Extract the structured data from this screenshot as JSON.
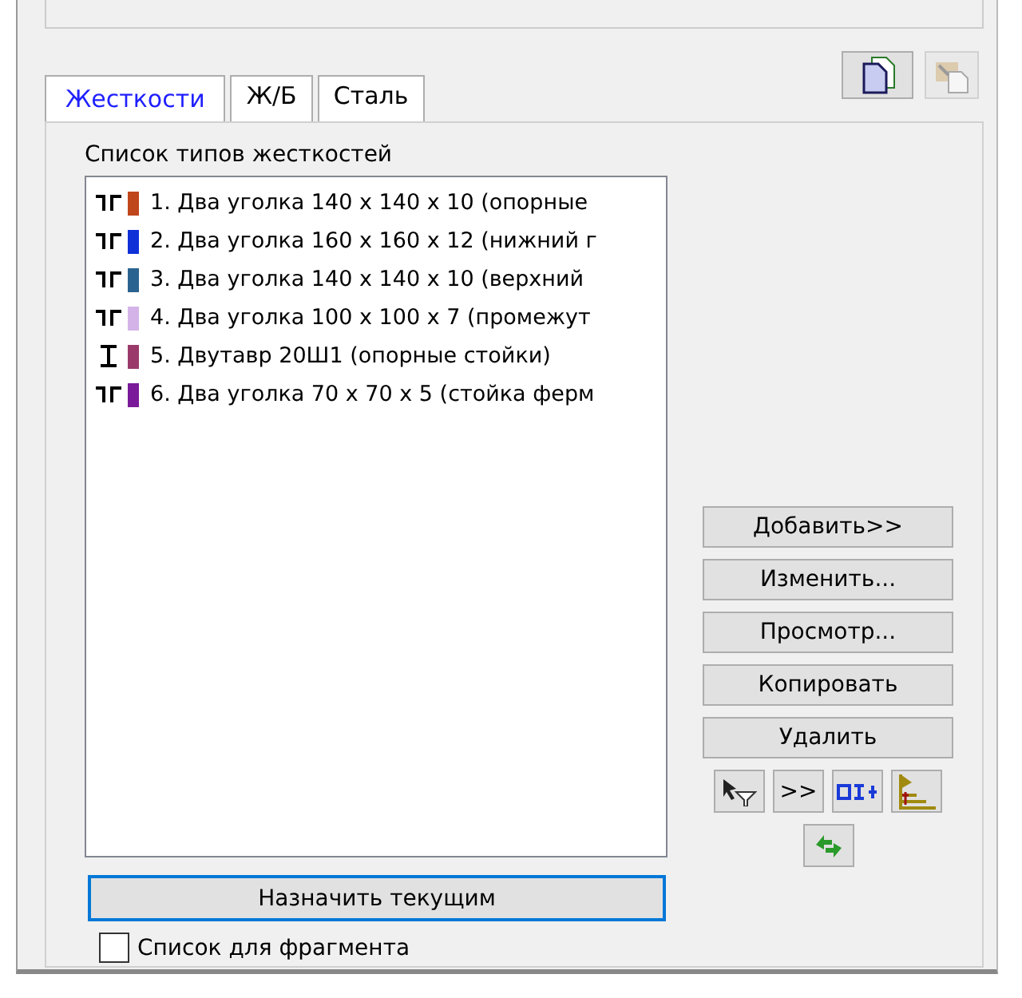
{
  "tabs": [
    {
      "label": "Жесткости",
      "selected": true
    },
    {
      "label": "Ж/Б",
      "selected": false
    },
    {
      "label": "Сталь",
      "selected": false
    }
  ],
  "toolbar": [
    {
      "kind": "copy",
      "disabled": false
    },
    {
      "kind": "paste",
      "disabled": true
    }
  ],
  "list": {
    "label": "Список типов жесткостей",
    "items": [
      {
        "kind": "angles",
        "color": "#c0461b",
        "text": "1. Два уголка 140 x 140 x 10 (опорные"
      },
      {
        "kind": "angles",
        "color": "#1030d8",
        "text": "2. Два уголка 160 x 160 x 12 (нижний г"
      },
      {
        "kind": "angles",
        "color": "#2a6390",
        "text": "3. Два уголка 140 x 140 x 10 (верхний"
      },
      {
        "kind": "angles",
        "color": "#d4b4e8",
        "text": "4. Два уголка 100 x 100 x 7 (промежут"
      },
      {
        "kind": "ibeam",
        "color": "#9a3a6a",
        "text": "5. Двутавр 20Ш1 (опорные стойки)"
      },
      {
        "kind": "angles",
        "color": "#7a1a9a",
        "text": "6. Два уголка 70 x 70 x 5 (стойка ферм"
      }
    ]
  },
  "buttons": [
    "Добавить>>",
    "Изменить...",
    "Просмотр...",
    "Копировать",
    "Удалить"
  ],
  "tool_icons": [
    {
      "kind": "filter"
    },
    {
      "kind": "more",
      "text": ">>"
    },
    {
      "kind": "section"
    },
    {
      "kind": "levels"
    }
  ],
  "refresh_icon": {
    "kind": "refresh"
  },
  "assign_button": "Назначить текущим",
  "fragment_checkbox": {
    "label": "Список для фрагмента",
    "checked": false
  }
}
